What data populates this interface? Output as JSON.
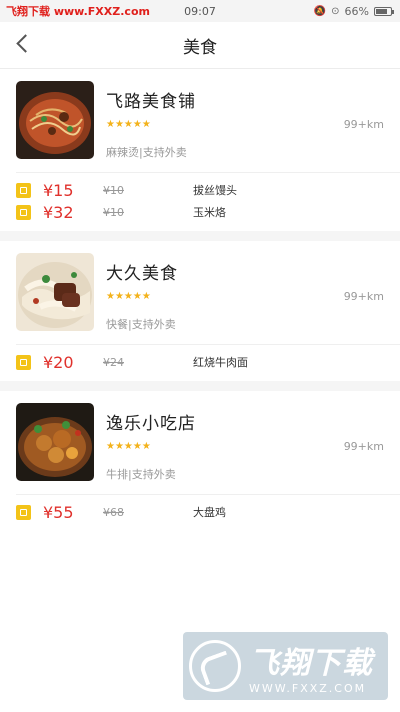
{
  "status_bar": {
    "watermark": "飞翔下载 www.FXXZ.com",
    "time": "09:07",
    "battery": "66%",
    "battery_level": 0.66
  },
  "header": {
    "title": "美食"
  },
  "shops": [
    {
      "name": "飞路美食铺",
      "rating": 5,
      "stars": "★★★★★",
      "tags": "麻辣烫|支持外卖",
      "distance": "99+km",
      "image_icon": "noodle-dish",
      "deals": [
        {
          "price": "¥15",
          "original": "¥10",
          "item": "拔丝馒头"
        },
        {
          "price": "¥32",
          "original": "¥10",
          "item": "玉米烙"
        }
      ]
    },
    {
      "name": "大久美食",
      "rating": 5,
      "stars": "★★★★★",
      "tags": "快餐|支持外卖",
      "distance": "99+km",
      "image_icon": "beef-noodle-dish",
      "deals": [
        {
          "price": "¥20",
          "original": "¥24",
          "item": "红烧牛肉面"
        }
      ]
    },
    {
      "name": "逸乐小吃店",
      "rating": 5,
      "stars": "★★★★★",
      "tags": "牛排|支持外卖",
      "distance": "99+km",
      "image_icon": "chicken-dish",
      "deals": [
        {
          "price": "¥55",
          "original": "¥68",
          "item": "大盘鸡"
        }
      ]
    }
  ],
  "watermark": {
    "title": "飞翔下载",
    "url": "WWW.FXXZ.COM"
  },
  "colors": {
    "price": "#e0312c",
    "star": "#f3b21b",
    "ticket": "#f3c318"
  }
}
